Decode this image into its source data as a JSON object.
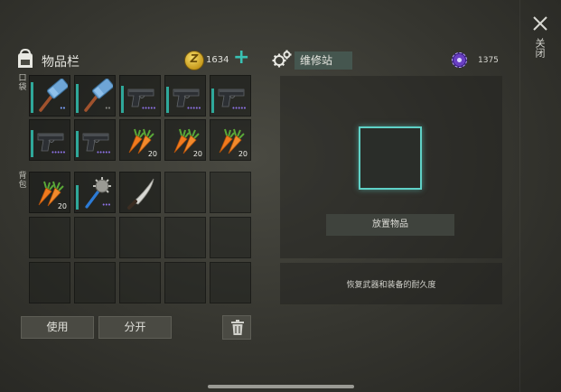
{
  "inventory": {
    "title": "物品栏",
    "coins": "1634",
    "quick_label": "口袋",
    "backpack_label": "背包"
  },
  "repair": {
    "title": "维修站",
    "currency": "1375",
    "place_button": "放置物品",
    "description": "恢复武器和装备的耐久度"
  },
  "close_label": "关闭",
  "buttons": {
    "use": "使用",
    "split": "分开"
  },
  "colors": {
    "accent": "#39c2b4",
    "durability": "#2fa89a",
    "rarity_purple": "#8e72e6",
    "slot_highlight": "#5fd1c7"
  },
  "pocket_items": [
    {
      "icon": "sledgehammer-icon",
      "qty": "",
      "dots": "••",
      "dotcolor": "#7ea3ff",
      "durability": 0.9
    },
    {
      "icon": "sledgehammer-icon",
      "qty": "",
      "dots": "••",
      "dotcolor": "#8b8b86",
      "durability": 0.85
    },
    {
      "icon": "pistol-icon",
      "qty": "",
      "dots": "•••••",
      "dotcolor": "#8e72e6",
      "durability": 0.8
    },
    {
      "icon": "pistol-icon",
      "qty": "",
      "dots": "•••••",
      "dotcolor": "#8e72e6",
      "durability": 0.75
    },
    {
      "icon": "pistol-icon",
      "qty": "",
      "dots": "•••••",
      "dotcolor": "#8e72e6",
      "durability": 0.7
    },
    {
      "icon": "pistol-icon",
      "qty": "",
      "dots": "•••••",
      "dotcolor": "#8e72e6",
      "durability": 0.8
    },
    {
      "icon": "pistol-icon",
      "qty": "",
      "dots": "•••••",
      "dotcolor": "#8e72e6",
      "durability": 0.75
    },
    {
      "icon": "carrot-icon",
      "qty": "20",
      "dots": "",
      "dotcolor": "",
      "durability": 0
    },
    {
      "icon": "carrot-icon",
      "qty": "20",
      "dots": "",
      "dotcolor": "",
      "durability": 0
    },
    {
      "icon": "carrot-icon",
      "qty": "20",
      "dots": "",
      "dotcolor": "",
      "durability": 0
    }
  ],
  "backpack_items": [
    {
      "icon": "carrot-icon",
      "qty": "20",
      "dots": "",
      "dotcolor": "",
      "durability": 0
    },
    {
      "icon": "mace-icon",
      "qty": "",
      "dots": "•••",
      "dotcolor": "#8e72e6",
      "durability": 0.7
    },
    {
      "icon": "machete-icon",
      "qty": "",
      "dots": "",
      "dotcolor": "",
      "durability": 0
    },
    {
      "icon": "",
      "qty": "",
      "dots": "",
      "dotcolor": "",
      "durability": 0
    },
    {
      "icon": "",
      "qty": "",
      "dots": "",
      "dotcolor": "",
      "durability": 0
    },
    {
      "icon": "",
      "qty": "",
      "dots": "",
      "dotcolor": "",
      "durability": 0
    },
    {
      "icon": "",
      "qty": "",
      "dots": "",
      "dotcolor": "",
      "durability": 0
    },
    {
      "icon": "",
      "qty": "",
      "dots": "",
      "dotcolor": "",
      "durability": 0
    },
    {
      "icon": "",
      "qty": "",
      "dots": "",
      "dotcolor": "",
      "durability": 0
    },
    {
      "icon": "",
      "qty": "",
      "dots": "",
      "dotcolor": "",
      "durability": 0
    },
    {
      "icon": "",
      "qty": "",
      "dots": "",
      "dotcolor": "",
      "durability": 0
    },
    {
      "icon": "",
      "qty": "",
      "dots": "",
      "dotcolor": "",
      "durability": 0
    },
    {
      "icon": "",
      "qty": "",
      "dots": "",
      "dotcolor": "",
      "durability": 0
    },
    {
      "icon": "",
      "qty": "",
      "dots": "",
      "dotcolor": "",
      "durability": 0
    },
    {
      "icon": "",
      "qty": "",
      "dots": "",
      "dotcolor": "",
      "durability": 0
    }
  ]
}
